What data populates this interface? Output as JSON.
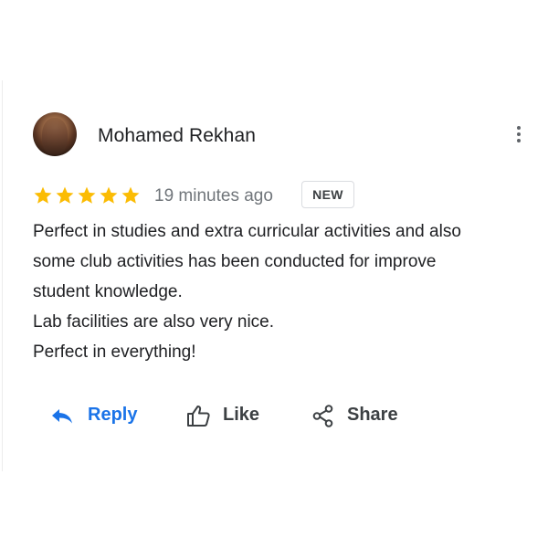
{
  "review": {
    "author": "Mohamed Rekhan",
    "rating": 5,
    "rating_max": 5,
    "star_color": "#fbbc04",
    "time_ago": "19 minutes ago",
    "badge": "NEW",
    "lines": [
      "Perfect in studies and extra curricular activities and also",
      "some club activities has been conducted for improve",
      "student knowledge.",
      "Lab facilities are also very nice.",
      "Perfect in everything!"
    ]
  },
  "actions": {
    "reply_label": "Reply",
    "like_label": "Like",
    "share_label": "Share",
    "reply_color": "#1a73e8"
  },
  "icons": {
    "more": "more-vert-icon",
    "reply": "reply-arrow-icon",
    "like": "thumbs-up-icon",
    "share": "share-icon",
    "star": "star-icon"
  }
}
